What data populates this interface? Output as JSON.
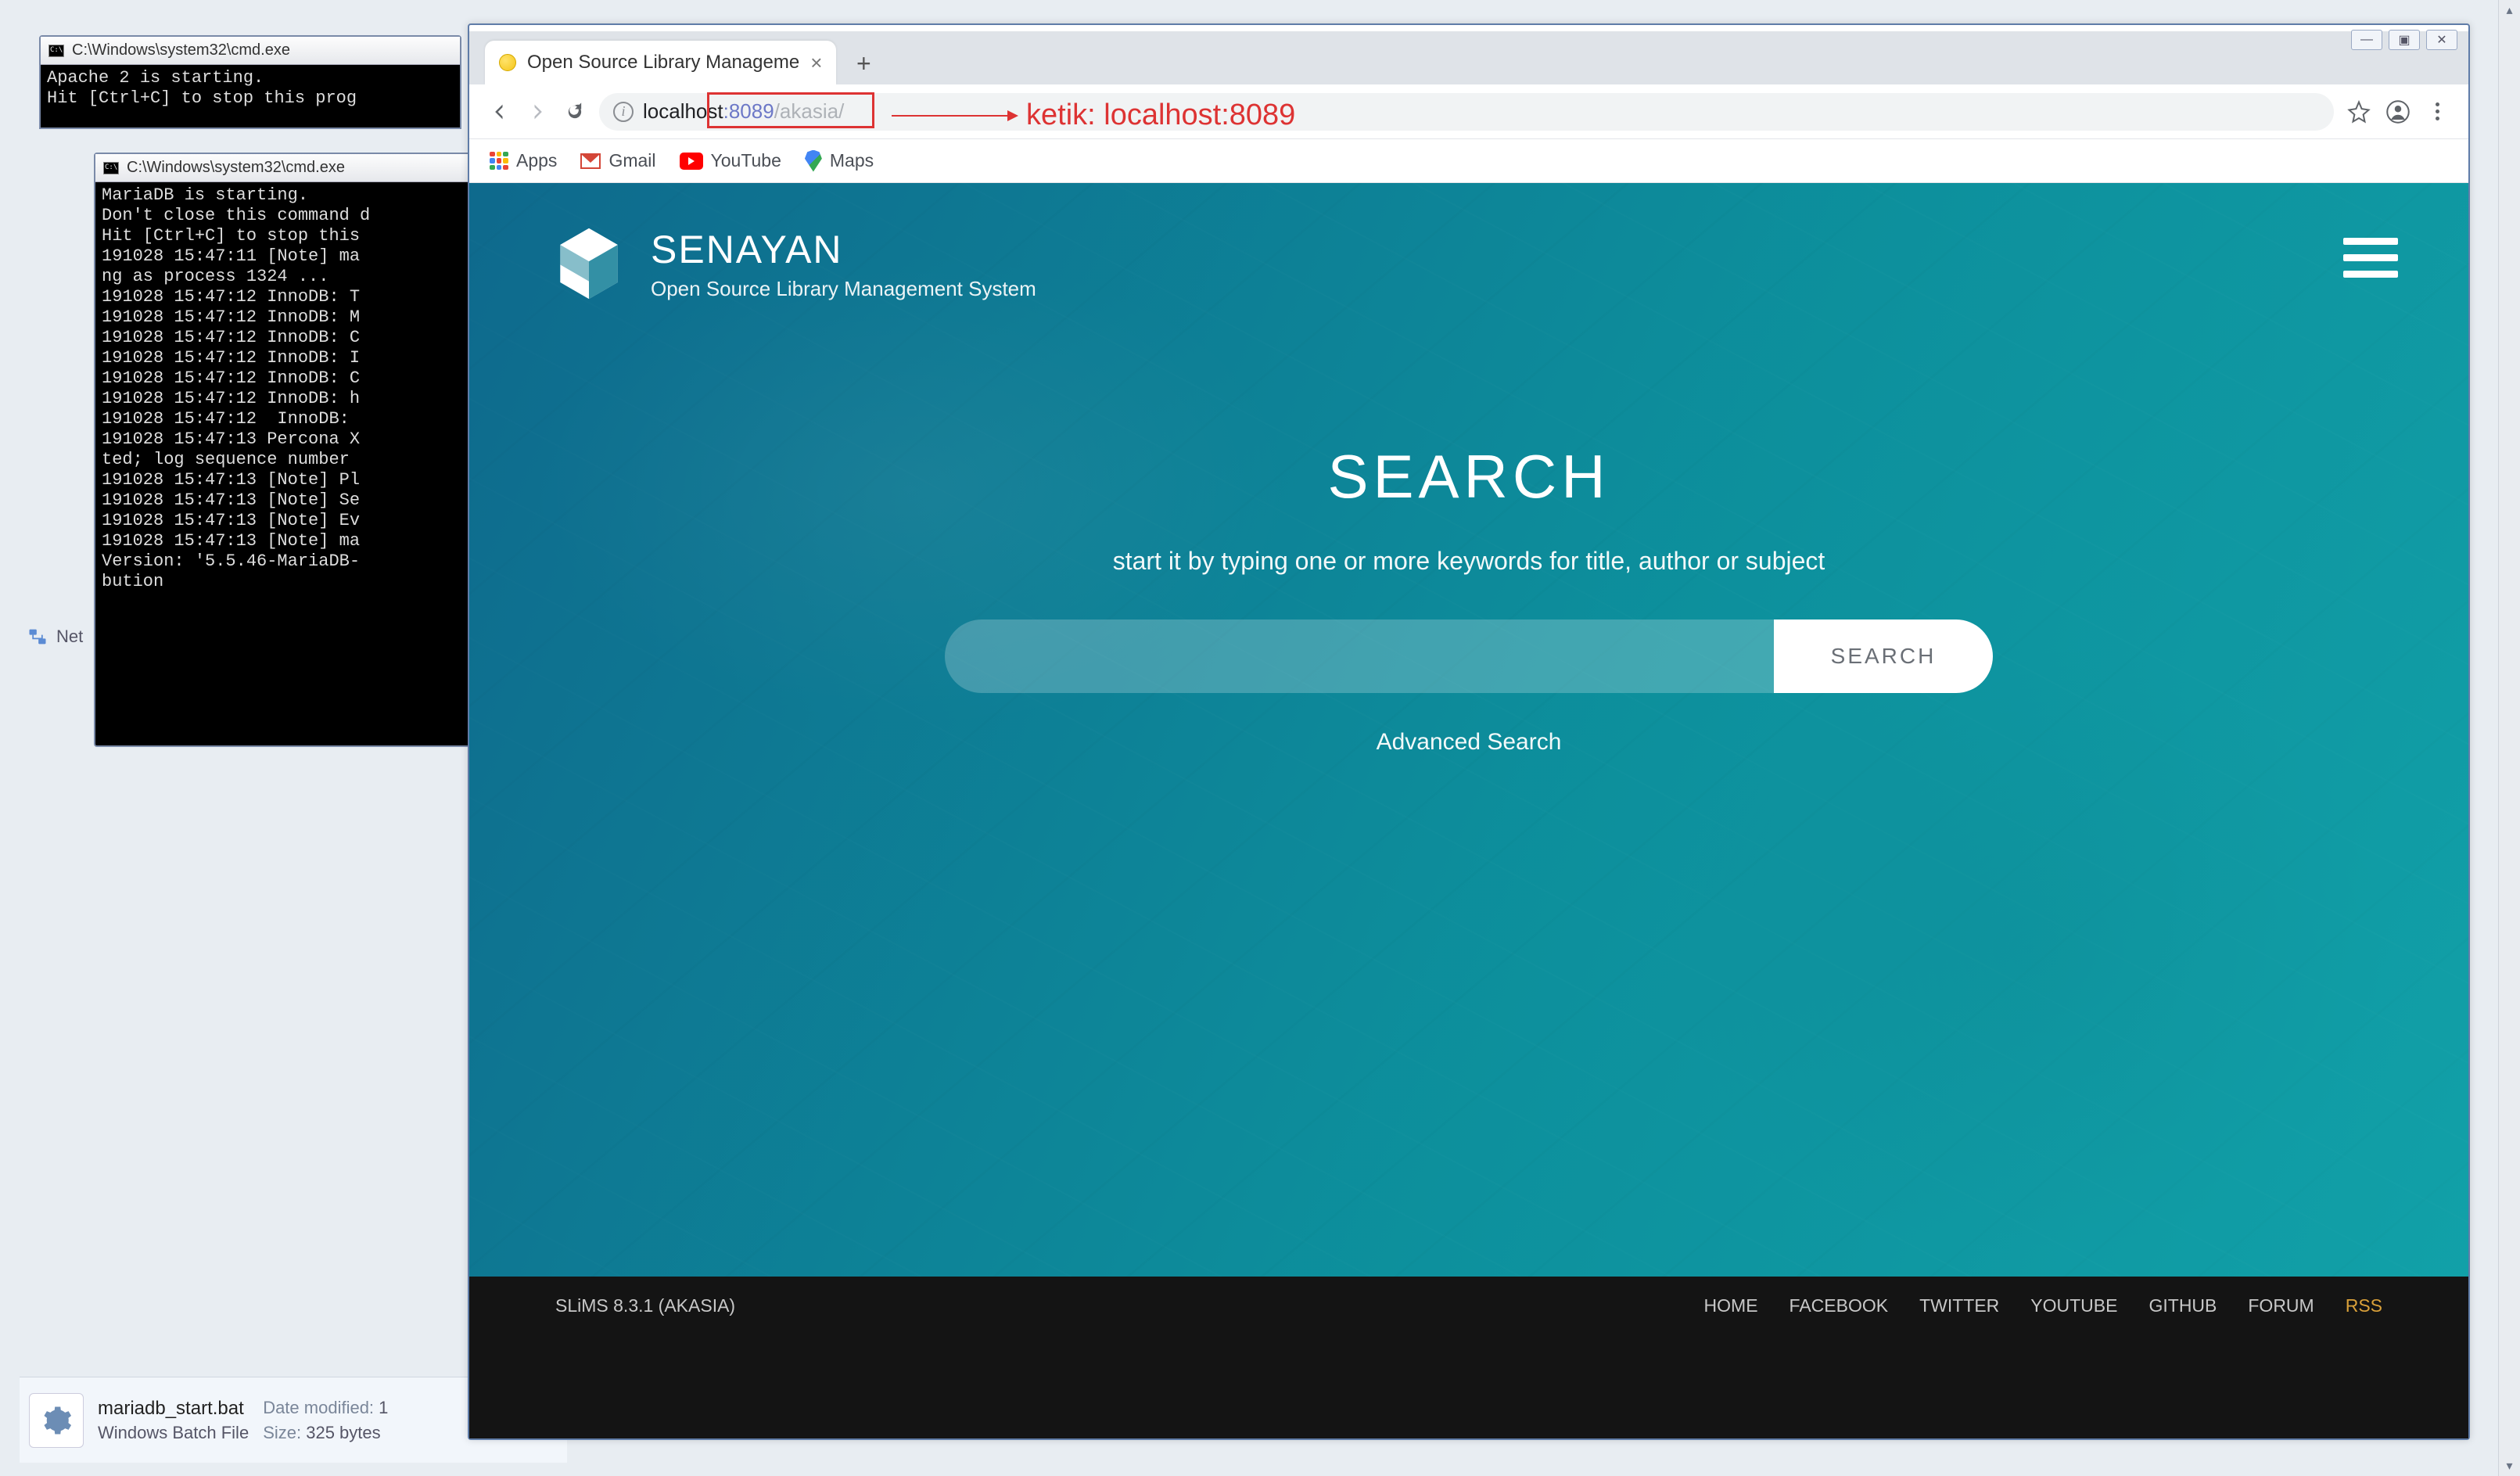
{
  "cmd1": {
    "title": "C:\\Windows\\system32\\cmd.exe",
    "lines": "Apache 2 is starting.\nHit [Ctrl+C] to stop this prog"
  },
  "cmd2": {
    "title": "C:\\Windows\\system32\\cmd.exe",
    "lines": "MariaDB is starting.\nDon't close this command d\nHit [Ctrl+C] to stop this \n191028 15:47:11 [Note] ma\nng as process 1324 ...\n191028 15:47:12 InnoDB: T\n191028 15:47:12 InnoDB: M\n191028 15:47:12 InnoDB: C\n191028 15:47:12 InnoDB: I\n191028 15:47:12 InnoDB: C\n191028 15:47:12 InnoDB: h\n191028 15:47:12  InnoDB: \n191028 15:47:13 Percona X\nted; log sequence number \n191028 15:47:13 [Note] Pl\n191028 15:47:13 [Note] Se\n191028 15:47:13 [Note] Ev\n191028 15:47:13 [Note] ma\nVersion: '5.5.46-MariaDB-\nbution"
  },
  "sidebar": {
    "network_label": "Net"
  },
  "explorer": {
    "filename": "mariadb_start.bat",
    "date_label": "Date modified:",
    "date_value": "1",
    "type_value": "Windows Batch File",
    "size_label": "Size:",
    "size_value": "325 bytes"
  },
  "chrome": {
    "win_min": "—",
    "win_max": "▣",
    "win_close": "✕",
    "tab_title": "Open Source Library Manageme",
    "url_host": "localhost",
    "url_port": ":8089",
    "url_path": "/akasia/",
    "bookmarks": {
      "apps": "Apps",
      "gmail": "Gmail",
      "youtube": "YouTube",
      "maps": "Maps"
    }
  },
  "annotation": {
    "text": "ketik: localhost:8089"
  },
  "page": {
    "brand_title": "SENAYAN",
    "brand_subtitle": "Open Source Library Management System",
    "search_title": "SEARCH",
    "search_sub": "start it by typing one or more keywords for title, author or subject",
    "search_btn": "SEARCH",
    "adv": "Advanced Search",
    "version": "SLiMS 8.3.1 (AKASIA)",
    "footer_links": [
      "HOME",
      "FACEBOOK",
      "TWITTER",
      "YOUTUBE",
      "GITHUB",
      "FORUM",
      "RSS"
    ]
  }
}
